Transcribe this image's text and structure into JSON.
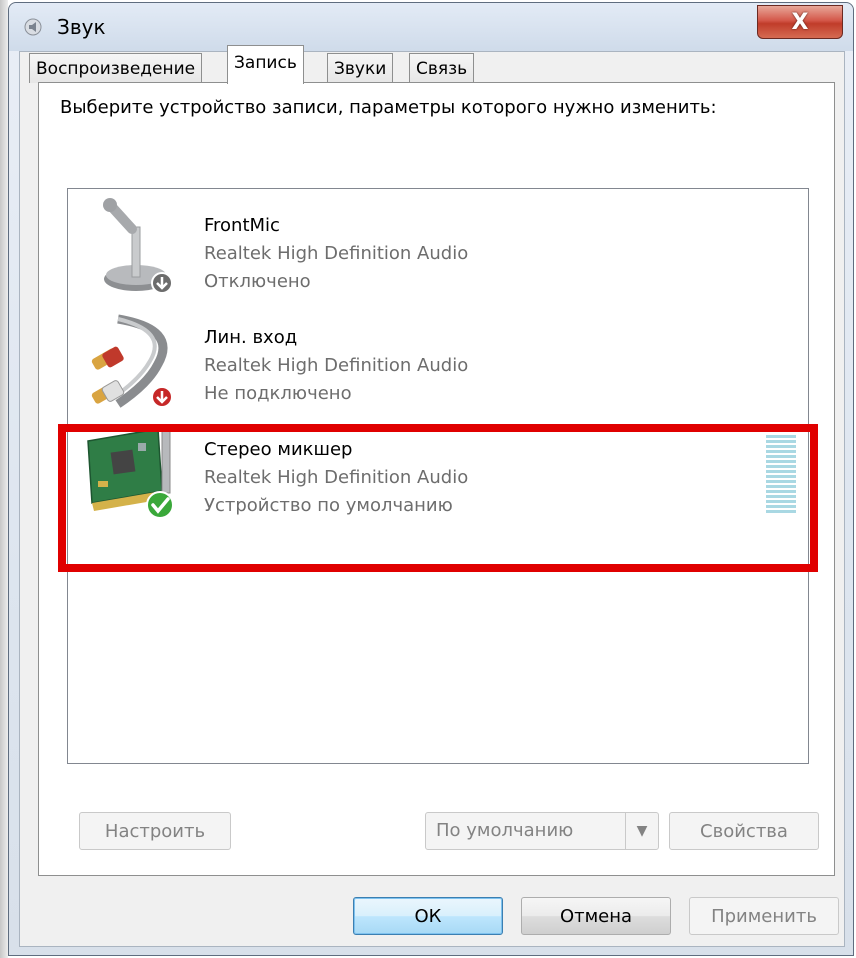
{
  "window": {
    "title": "Звук",
    "close_symbol": "X"
  },
  "tabs": [
    {
      "label": "Воспроизведение",
      "active": false
    },
    {
      "label": "Запись",
      "active": true
    },
    {
      "label": "Звуки",
      "active": false
    },
    {
      "label": "Связь",
      "active": false
    }
  ],
  "panel": {
    "instruction": "Выберите устройство записи, параметры которого нужно изменить:"
  },
  "devices": [
    {
      "name": "FrontMic",
      "driver": "Realtek High Definition Audio",
      "status": "Отключено",
      "icon": "microphone-icon",
      "badge": "disabled-down-arrow"
    },
    {
      "name": "Лин. вход",
      "driver": "Realtek High Definition Audio",
      "status": "Не подключено",
      "icon": "rca-cable-icon",
      "badge": "unplugged-down-arrow"
    },
    {
      "name": "Стерео микшер",
      "driver": "Realtek High Definition Audio",
      "status": "Устройство по умолчанию",
      "icon": "sound-card-icon",
      "badge": "default-checkmark"
    }
  ],
  "buttons": {
    "configure": "Настроить",
    "set_default": "По умолчанию",
    "properties": "Свойства",
    "ok": "ОК",
    "cancel": "Отмена",
    "apply": "Применить"
  },
  "colors": {
    "highlight": "#e00000",
    "default_badge": "#3aa83a",
    "disabled_badge": "#6c6c6c"
  }
}
